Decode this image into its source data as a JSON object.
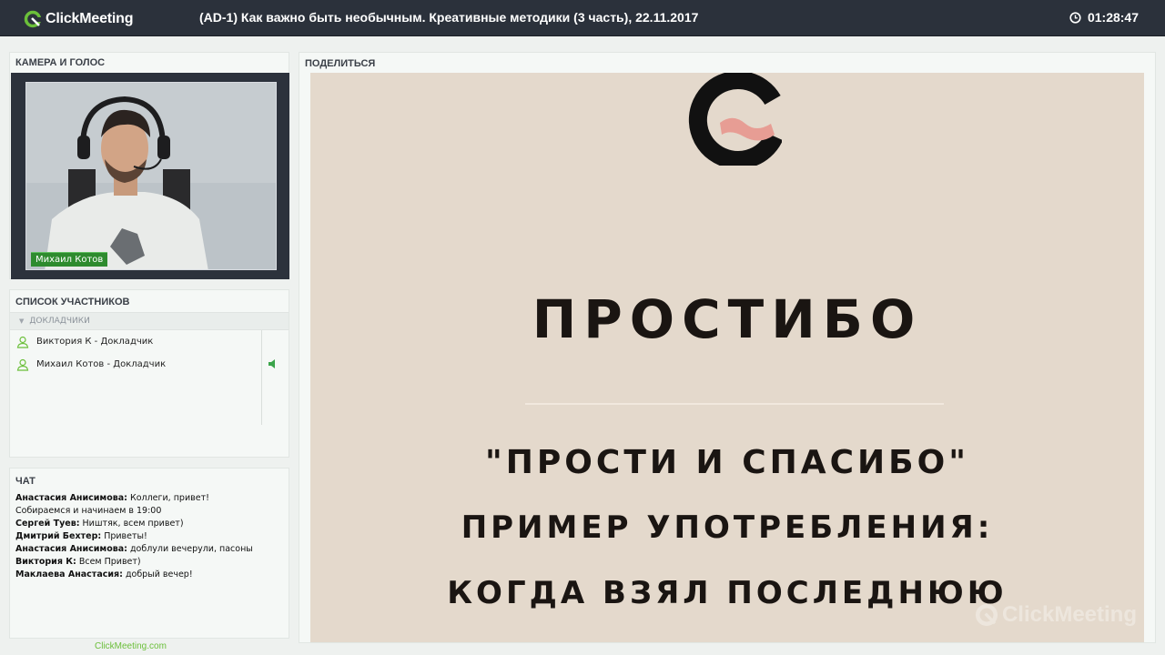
{
  "app": {
    "brand": "ClickMeeting",
    "accent": "#6bbf3a"
  },
  "header": {
    "title": "(AD-1) Как важно быть необычным. Креативные методики (3 часть), 22.11.2017",
    "timer": "01:28:47",
    "timer_icon": "clock-icon"
  },
  "camera": {
    "title": "КАМЕРА И ГОЛОС",
    "presenter_name": "Михаил Котов"
  },
  "participants": {
    "title": "СПИСОК УЧАСТНИКОВ",
    "group_label": "ДОКЛАДЧИКИ",
    "items": [
      {
        "label": "Виктория К - Докладчик",
        "icon": "user-icon",
        "speaking": false
      },
      {
        "label": "Михаил Котов - Докладчик",
        "icon": "user-icon",
        "speaking": true
      }
    ]
  },
  "chat": {
    "title": "ЧАТ",
    "messages": [
      {
        "author": "Анастасия Анисимова:",
        "text": " Коллеги, привет!"
      },
      {
        "author": "",
        "text": "Собираемся и начинаем в 19:00"
      },
      {
        "author": "Сергей Туев:",
        "text": " Ништяк, всем привет)"
      },
      {
        "author": "Дмитрий Бехтер:",
        "text": " Приветы!"
      },
      {
        "author": "Анастасия Анисимова:",
        "text": " доблули вечерули, пасоны"
      },
      {
        "author": "Виктория К:",
        "text": " Всем Привет)"
      },
      {
        "author": "Маклаева Анастасия:",
        "text": " добрый вечер!"
      }
    ]
  },
  "share": {
    "title": "ПОДЕЛИТЬСЯ",
    "slide": {
      "heading": "ПРОСТИБО",
      "quote": "\"ПРОСТИ И СПАСИБО\"",
      "example": "ПРИМЕР УПОТРЕБЛЕНИЯ:",
      "when": "КОГДА ВЗЯЛ ПОСЛЕДНЮЮ",
      "watermark": "ClickMeeting"
    }
  },
  "footer": {
    "link": "ClickMeeting.com"
  }
}
